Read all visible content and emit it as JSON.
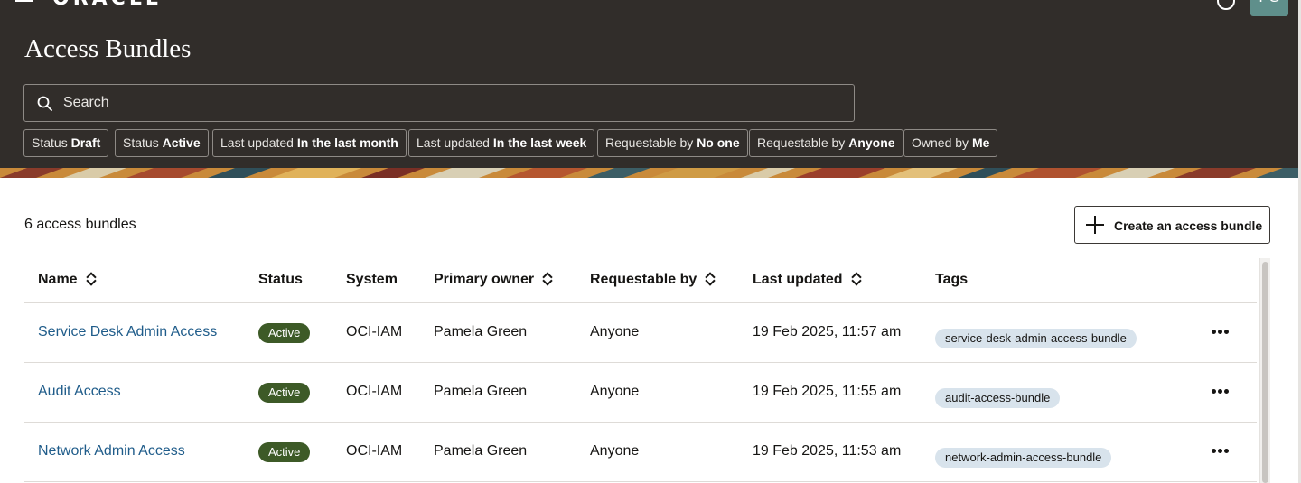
{
  "header": {
    "logo": "ORACLE",
    "avatar_initials": "PG",
    "title": "Access Bundles"
  },
  "search": {
    "placeholder": "Search"
  },
  "filters": [
    {
      "label": "Status",
      "value": "Draft"
    },
    {
      "label": "Status",
      "value": "Active"
    },
    {
      "label": "Last updated",
      "value": "In the last month"
    },
    {
      "label": "Last updated",
      "value": "In the last week"
    },
    {
      "label": "Requestable by",
      "value": "No one"
    },
    {
      "label": "Requestable by",
      "value": "Anyone"
    },
    {
      "label": "Owned by",
      "value": "Me"
    }
  ],
  "summary": {
    "count_text": "6 access bundles"
  },
  "actions": {
    "create_label": "Create an access bundle"
  },
  "table": {
    "columns": [
      "Name",
      "Status",
      "System",
      "Primary owner",
      "Requestable by",
      "Last updated",
      "Tags"
    ],
    "rows": [
      {
        "name": "Service Desk Admin Access",
        "status": "Active",
        "system": "OCI-IAM",
        "owner": "Pamela Green",
        "requestable": "Anyone",
        "updated": "19 Feb 2025, 11:57 am",
        "tag": "service-desk-admin-access-bundle"
      },
      {
        "name": "Audit Access",
        "status": "Active",
        "system": "OCI-IAM",
        "owner": "Pamela Green",
        "requestable": "Anyone",
        "updated": "19 Feb 2025, 11:55 am",
        "tag": "audit-access-bundle"
      },
      {
        "name": "Network Admin Access",
        "status": "Active",
        "system": "OCI-IAM",
        "owner": "Pamela Green",
        "requestable": "Anyone",
        "updated": "19 Feb 2025, 11:53 am",
        "tag": "network-admin-access-bundle"
      }
    ]
  },
  "colors": {
    "header_bg": "#312d2a",
    "link": "#1f5c8a",
    "active_badge": "#3d5a27",
    "tag_bg": "#d8e3ec"
  }
}
